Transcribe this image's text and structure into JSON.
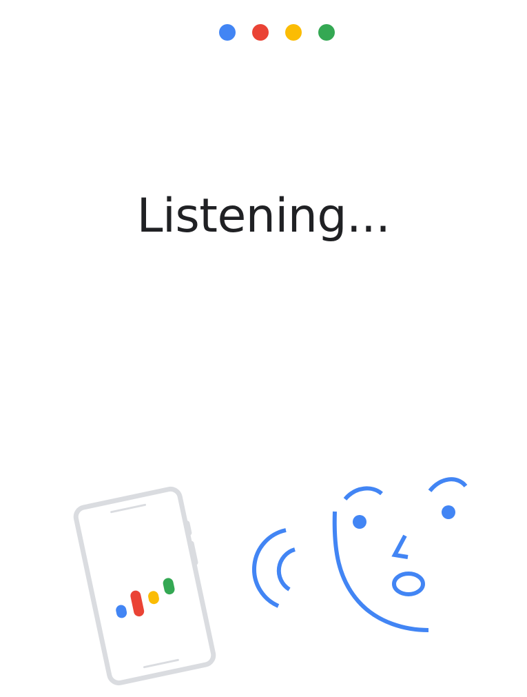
{
  "status": {
    "title": "Listening..."
  },
  "indicator_dots": [
    {
      "name": "blue-dot",
      "color": "#4285F4"
    },
    {
      "name": "red-dot",
      "color": "#EA4335"
    },
    {
      "name": "yellow-dot",
      "color": "#FBBC04"
    },
    {
      "name": "green-dot",
      "color": "#34A853"
    }
  ],
  "colors": {
    "blue": "#4285F4",
    "red": "#EA4335",
    "yellow": "#FBBC04",
    "green": "#34A853",
    "phone_outline": "#DADCE0",
    "text": "#202124"
  },
  "illustration": {
    "phone_icon": "phone-with-assistant-bars-icon",
    "sound_waves_icon": "sound-waves-icon",
    "face_icon": "speaking-face-icon"
  }
}
